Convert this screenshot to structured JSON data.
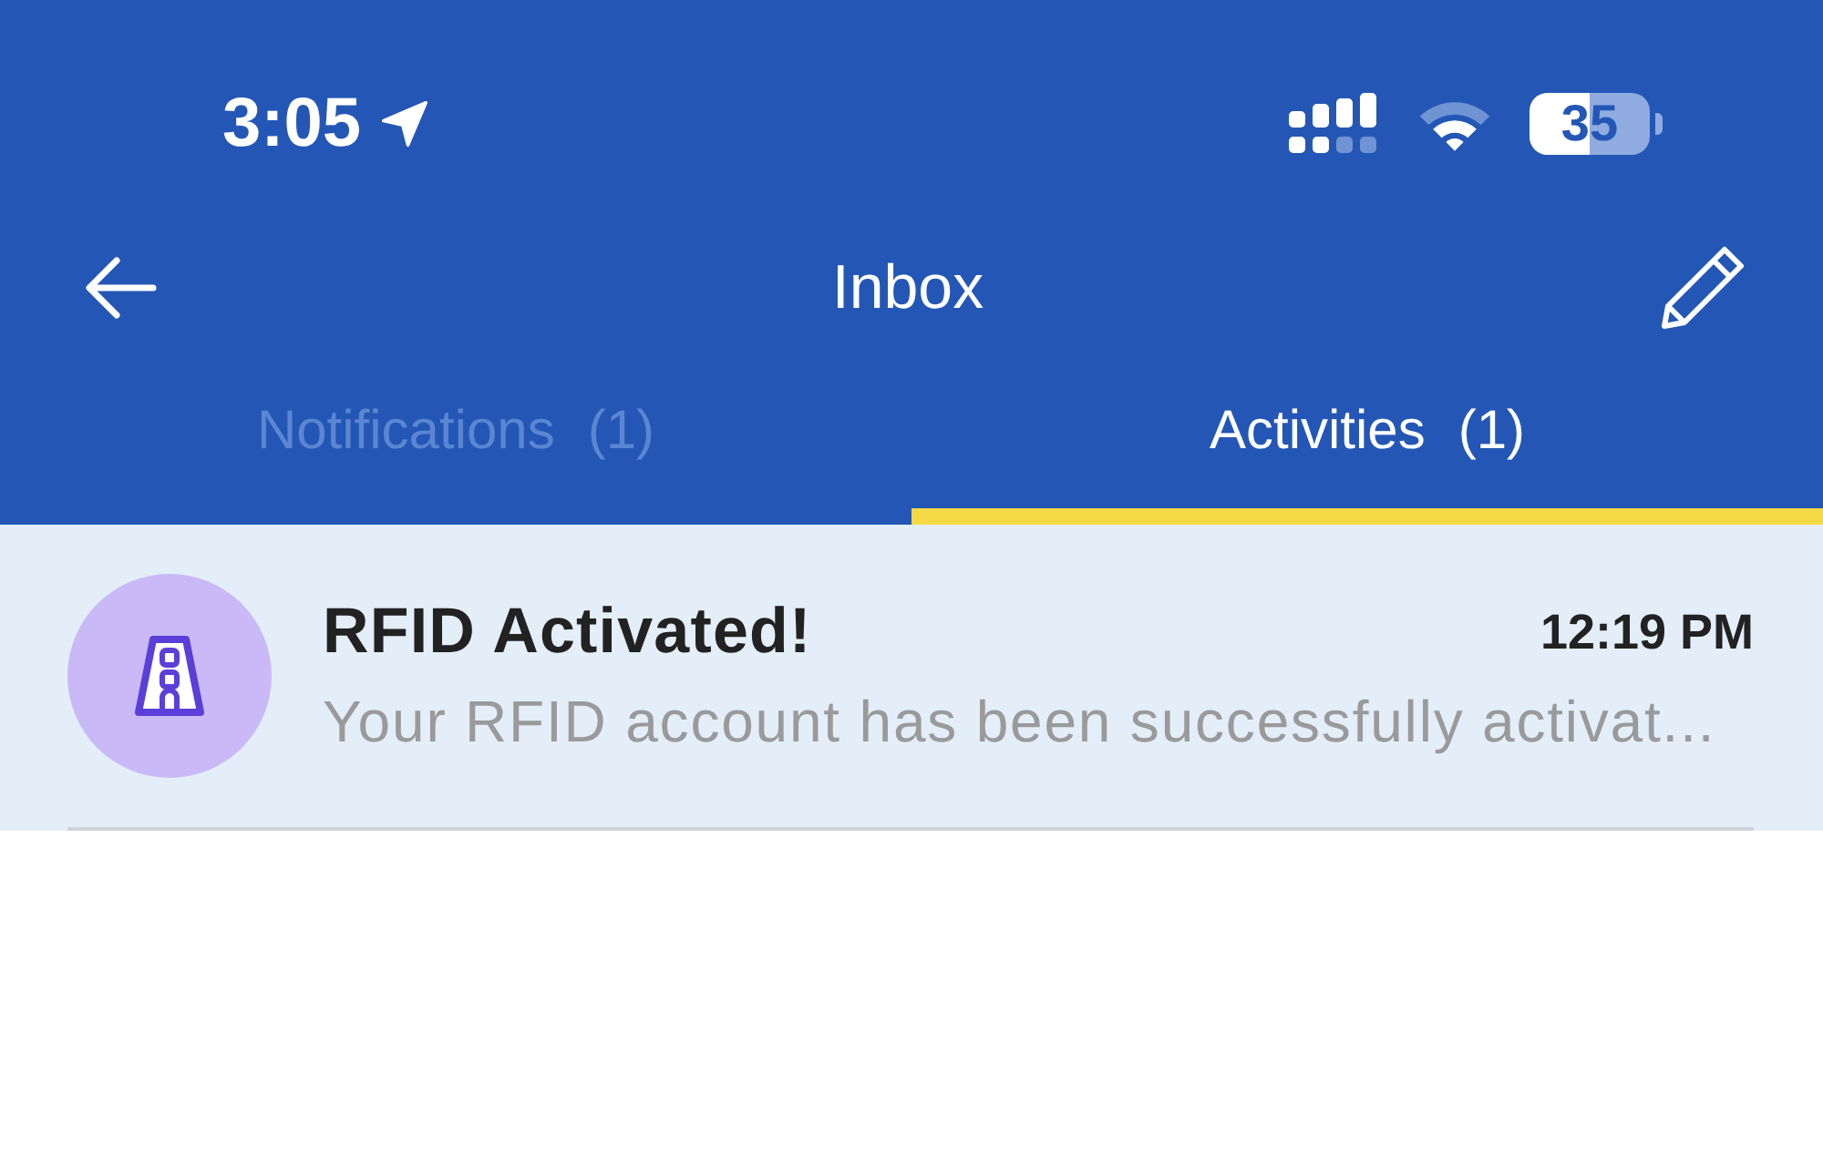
{
  "status_bar": {
    "time": "3:05",
    "battery": "35"
  },
  "nav": {
    "title": "Inbox"
  },
  "tabs": [
    {
      "label": "Notifications",
      "count": "(1)",
      "selected": false
    },
    {
      "label": "Activities",
      "count": "(1)",
      "selected": true
    }
  ],
  "messages": [
    {
      "title": "RFID Activated!",
      "time": "12:19 PM",
      "preview": "Your RFID account has been successfully activat...",
      "unread": true
    }
  ]
}
